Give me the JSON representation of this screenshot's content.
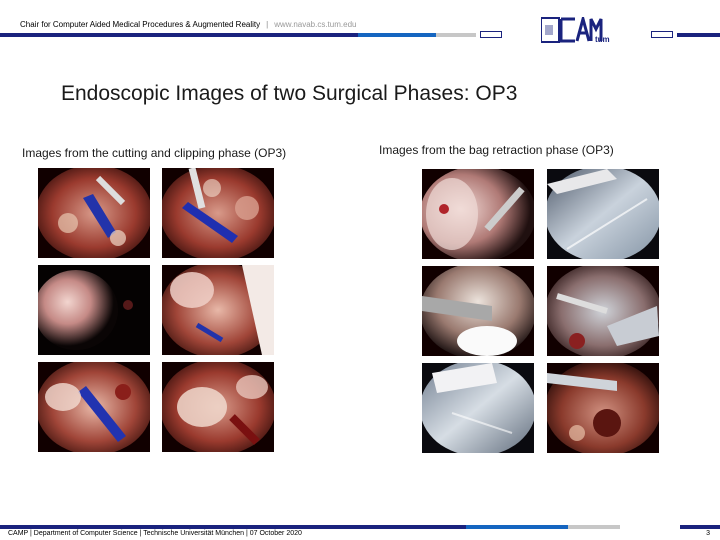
{
  "header": {
    "chair": "Chair for Computer Aided Medical Procedures & Augmented Reality",
    "separator": "|",
    "url": "www.navab.cs.tum.edu"
  },
  "logo": {
    "text": "CAMP",
    "sub": "tum"
  },
  "colors": {
    "navy": "#1a237e",
    "blue": "#1565c0",
    "grey": "#c7c7c7"
  },
  "title": "Endoscopic Images of two Surgical Phases: OP3",
  "left_caption": "Images from the cutting and clipping phase (OP3)",
  "right_caption": "Images from the bag retraction phase (OP3)",
  "footer": {
    "text": "CAMP | Department of Computer Science | Technische Universität München | 07 October 2020",
    "page": "3"
  }
}
